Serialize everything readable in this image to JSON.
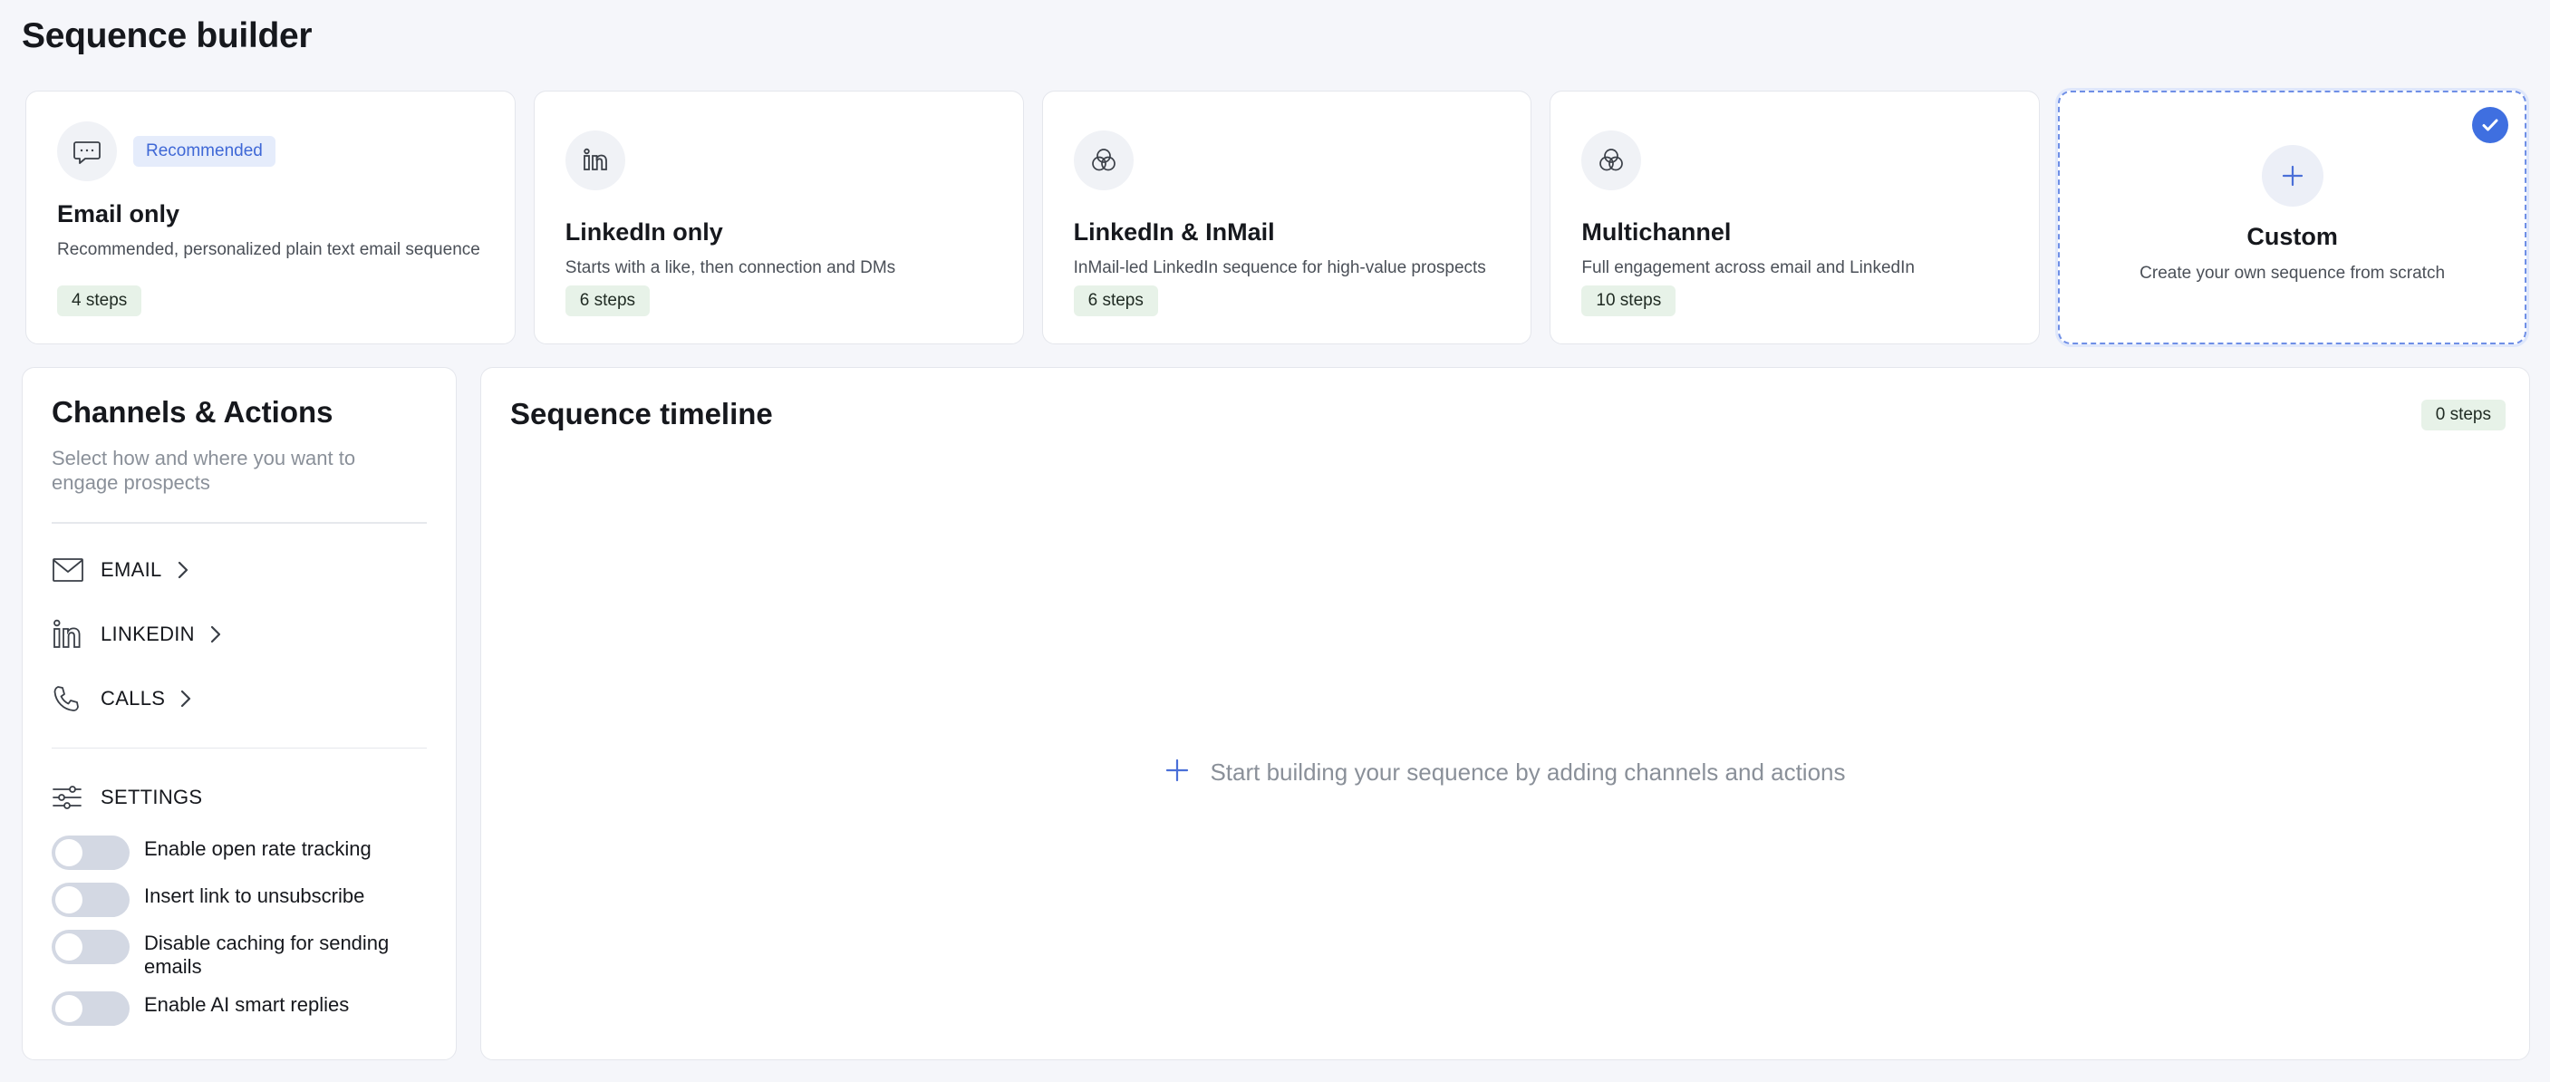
{
  "page": {
    "title": "Sequence builder"
  },
  "templates": [
    {
      "id": "email",
      "icon": "chat-bubble-icon",
      "badge": "Recommended",
      "title": "Email only",
      "description": "Recommended, personalized plain text email sequence",
      "steps": "4 steps"
    },
    {
      "id": "linkedin",
      "icon": "linkedin-icon",
      "title": "LinkedIn only",
      "description": "Starts with a like, then connection and DMs",
      "steps": "6 steps"
    },
    {
      "id": "inmail",
      "icon": "overlapping-circles-icon",
      "title": "LinkedIn & InMail",
      "description": "InMail-led LinkedIn sequence for high-value prospects",
      "steps": "6 steps"
    },
    {
      "id": "multichannel",
      "icon": "overlapping-circles-icon",
      "title": "Multichannel",
      "description": "Full engagement across email and LinkedIn",
      "steps": "10 steps"
    },
    {
      "id": "custom",
      "icon": "plus-icon",
      "title": "Custom",
      "description": "Create your own sequence from scratch",
      "selected": true
    }
  ],
  "channels_panel": {
    "title": "Channels & Actions",
    "subtitle": "Select how and where you want to engage prospects",
    "channels": [
      {
        "icon": "envelope-icon",
        "label": "EMAIL"
      },
      {
        "icon": "linkedin-icon",
        "label": "LINKEDIN"
      },
      {
        "icon": "phone-icon",
        "label": "CALLS"
      }
    ],
    "settings": {
      "icon": "sliders-icon",
      "label": "SETTINGS",
      "toggles": [
        {
          "label": "Enable open rate tracking",
          "on": false
        },
        {
          "label": "Insert link to unsubscribe",
          "on": false
        },
        {
          "label": "Disable caching for sending emails",
          "on": false
        },
        {
          "label": "Enable AI smart replies",
          "on": false
        }
      ]
    }
  },
  "timeline": {
    "title": "Sequence timeline",
    "steps_count": "0 steps",
    "empty_message": "Start building your sequence by adding channels and actions"
  },
  "colors": {
    "accent": "#3f6fe0",
    "badge_bg": "#e5ecfb",
    "steps_chip_bg": "#e7f2e8",
    "page_bg": "#f5f6fa",
    "toggle_off": "#d3d8e3"
  }
}
